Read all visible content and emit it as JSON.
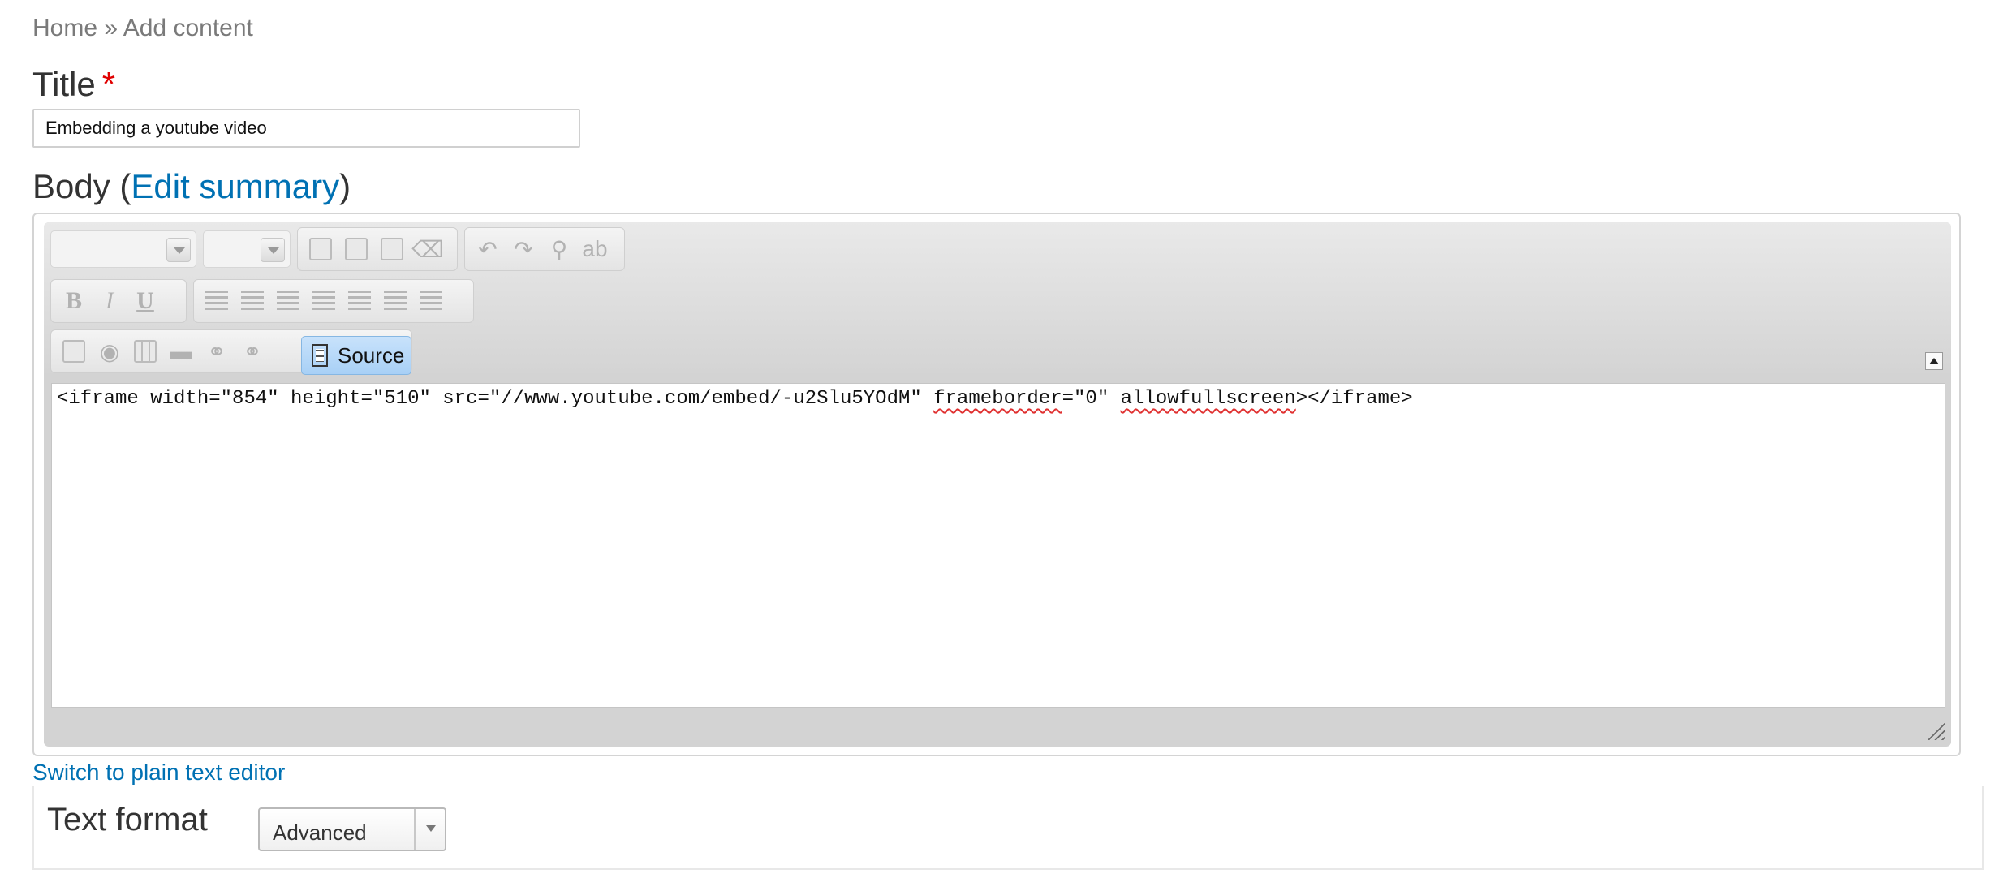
{
  "breadcrumb": {
    "home": "Home",
    "separator": " » ",
    "current": "Add content"
  },
  "title_field": {
    "label": "Title",
    "required_marker": "*",
    "value": "Embedding a youtube video"
  },
  "body_field": {
    "label_prefix": "Body (",
    "edit_summary": "Edit summary",
    "label_suffix": ")"
  },
  "editor": {
    "source_button": "Source",
    "source_pre": "<iframe width=\"854\" height=\"510\" src=\"//www.youtube.com/embed/-u2Slu5YOdM\" ",
    "source_misspelled_1": "frameborder",
    "source_mid": "=\"0\" ",
    "source_misspelled_2": "allowfullscreen",
    "source_post": "></iframe>",
    "toolbar_bold": "B",
    "toolbar_italic": "I",
    "toolbar_underline": "U"
  },
  "switch_link": "Switch to plain text editor",
  "text_format": {
    "label": "Text format",
    "selected": "Advanced"
  }
}
